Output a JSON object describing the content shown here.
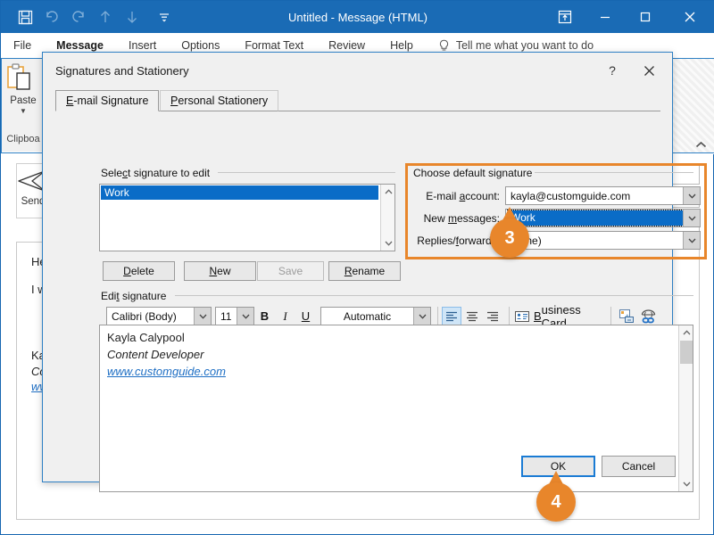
{
  "window": {
    "title": "Untitled  -  Message (HTML)",
    "quick_access": [
      "save-icon",
      "undo-icon",
      "redo-icon",
      "up-arrow-icon",
      "down-arrow-icon",
      "qat-more-icon"
    ],
    "controls": [
      "ribbon-display-options-icon",
      "minimize-icon",
      "maximize-icon",
      "close-icon"
    ]
  },
  "ribbon": {
    "tabs": [
      "File",
      "Message",
      "Insert",
      "Options",
      "Format Text",
      "Review",
      "Help"
    ],
    "active_tab": "Message",
    "tell_me": "Tell me what you want to do",
    "paste_label": "Paste",
    "clipboard_group_label": "Clipboa",
    "collapse_icon": "chevron-up-icon"
  },
  "message": {
    "send_label": "Send",
    "body_lines": [
      "Hey ",
      "I war"
    ],
    "signature_lines": [
      "Kayla",
      "Cont",
      "www"
    ]
  },
  "dialog": {
    "title": "Signatures and Stationery",
    "help_glyph": "?",
    "close_glyph": "✕",
    "tabs": [
      {
        "label": "E-mail Signature",
        "active": true
      },
      {
        "label": "Personal Stationery",
        "active": false
      }
    ],
    "select_signature": {
      "group_label": "Select signature to edit",
      "items": [
        "Work"
      ],
      "selected": "Work",
      "buttons": [
        {
          "label": "Delete",
          "disabled": false
        },
        {
          "label": "New",
          "disabled": false
        },
        {
          "label": "Save",
          "disabled": true
        },
        {
          "label": "Rename",
          "disabled": false
        }
      ]
    },
    "choose_default": {
      "group_label": "Choose default signature",
      "highlight_color": "#e8862b",
      "fields": [
        {
          "label": "E-mail account:",
          "value": "kayla@customguide.com",
          "selected": false
        },
        {
          "label": "New messages:",
          "value": "Work",
          "selected": true
        },
        {
          "label": "Replies/forwards:",
          "value": "(none)",
          "selected": false
        }
      ]
    },
    "edit_signature": {
      "group_label": "Edit signature",
      "font_family": "Calibri (Body)",
      "font_size": "11",
      "bold": "B",
      "italic": "I",
      "underline": "U",
      "font_color": "Automatic",
      "align_left_icon": "align-left-icon",
      "align_center_icon": "align-center-icon",
      "align_right_icon": "align-right-icon",
      "business_card_label": "Business Card",
      "picture_icon": "insert-picture-icon",
      "hyperlink_icon": "insert-hyperlink-icon",
      "content": [
        {
          "text": "Kayla Calypool",
          "style": "normal"
        },
        {
          "text": "Content Developer",
          "style": "italic"
        },
        {
          "text": "www.customguide.com",
          "style": "link"
        }
      ]
    },
    "footer_buttons": [
      {
        "label": "OK",
        "default": true
      },
      {
        "label": "Cancel",
        "default": false
      }
    ]
  },
  "callouts": [
    {
      "number": "3",
      "points_to": "choose-default-signature-group"
    },
    {
      "number": "4",
      "points_to": "ok-button"
    }
  ],
  "colors": {
    "title_bar": "#1a6bb5",
    "accent_orange": "#e8862b",
    "selection_blue": "#0a6cc7",
    "dialog_bg": "#f0f0f0"
  }
}
